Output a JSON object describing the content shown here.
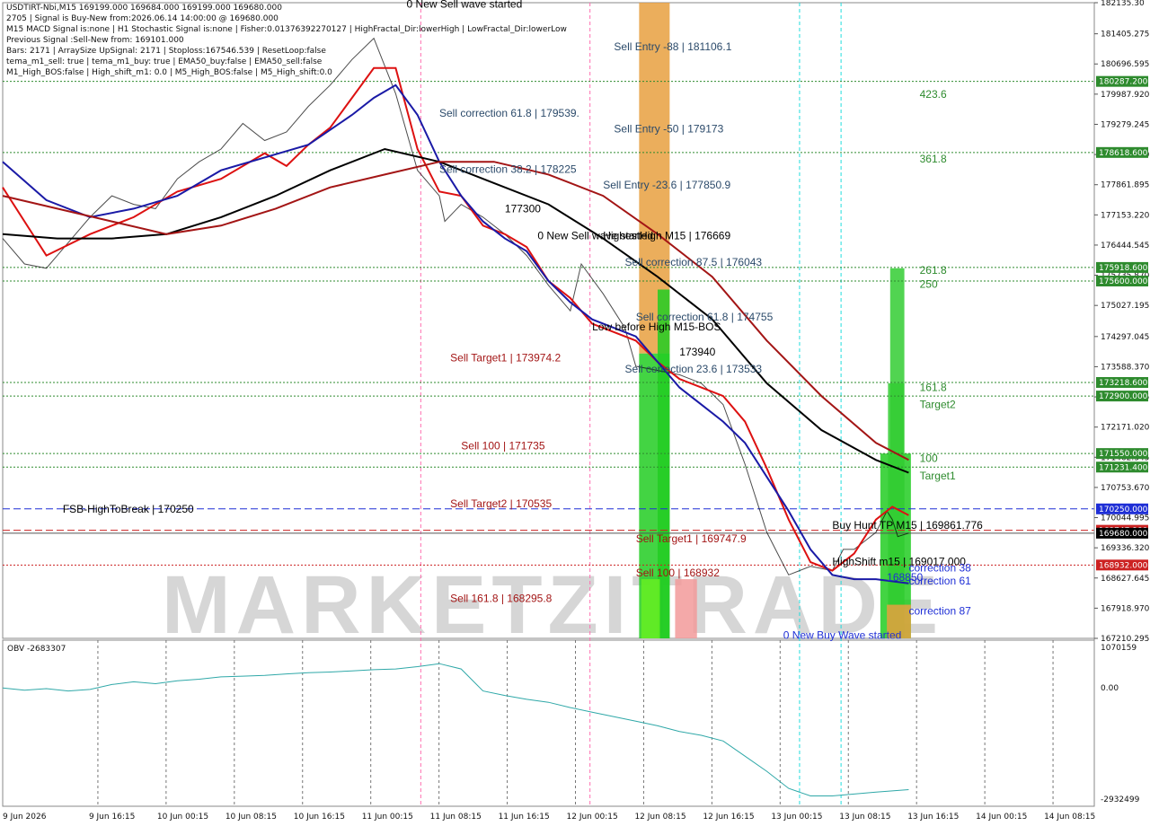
{
  "window": {
    "title": "USDTIRT-Nbi,M15  169199.000 169684.000 169199.000 169680.000"
  },
  "info_lines": [
    "USDTIRT-Nbi,M15  169199.000 169684.000 169199.000 169680.000",
    "2705 | Signal is Buy-New from:2026.06.14 14:00:00 @ 169680.000",
    "M15 MACD Signal is:none | H1 Stochastic Signal is:none | Fisher:0.01376392270127 | HighFractal_Dir:lowerHigh | LowFractal_Dir:lowerLow",
    "Previous Signal :Sell-New from: 169101.000",
    "Bars: 2171 | ArraySize UpSignal: 2171 | Stoploss:167546.539 | ResetLoop:false",
    "tema_m1_sell: true | tema_m1_buy: true | EMA50_buy:false | EMA50_sell:false",
    "M1_High_BOS:false | High_shift_m1: 0.0 | M5_High_BOS:false | M5_High_shift:0.0"
  ],
  "watermark": "MARKETZITRADE",
  "colors": {
    "ema_red": "#dd1111",
    "ema_blue": "#1a1aa6",
    "ema_black": "#000000",
    "ema_darkred": "#a31515",
    "level_green": "#2e8b2e",
    "level_red": "#cc2222",
    "level_blue": "#1f2fd6",
    "bar_green": "#22cc22",
    "bar_orange": "#e8a040",
    "obv_line": "#2fa8a8"
  },
  "chart_data": {
    "type": "line",
    "symbol": "USDTIRT-Nbi",
    "timeframe": "M15",
    "ylim": [
      167210.295,
      182135.3
    ],
    "price_ticks": [
      "182135.30",
      "181405.275",
      "180696.595",
      "179987.920",
      "179279.245",
      "178570.570",
      "177861.895",
      "177153.220",
      "176444.545",
      "175735.870",
      "175027.195",
      "174297.045",
      "173588.370",
      "172879.695",
      "172171.020",
      "171462.345",
      "170753.670",
      "170044.995",
      "169336.320",
      "168627.645",
      "167918.970",
      "167210.295"
    ],
    "time_labels": [
      "9 Jun 2026",
      "9 Jun 16:15",
      "10 Jun 00:15",
      "10 Jun 08:15",
      "10 Jun 16:15",
      "11 Jun 00:15",
      "11 Jun 08:15",
      "11 Jun 16:15",
      "12 Jun 00:15",
      "12 Jun 08:15",
      "12 Jun 16:15",
      "13 Jun 00:15",
      "13 Jun 08:15",
      "13 Jun 16:15",
      "14 Jun 00:15",
      "14 Jun 08:15"
    ],
    "price_tags": [
      {
        "value": 180287.2,
        "text": "180287.200",
        "color": "#2e8b2e"
      },
      {
        "value": 178618.6,
        "text": "178618.600",
        "color": "#2e8b2e"
      },
      {
        "value": 175918.6,
        "text": "175918.600",
        "color": "#2e8b2e"
      },
      {
        "value": 175600.0,
        "text": "175600.000",
        "color": "#2e8b2e"
      },
      {
        "value": 173218.6,
        "text": "173218.600",
        "color": "#2e8b2e"
      },
      {
        "value": 172900.0,
        "text": "172900.000",
        "color": "#2e8b2e"
      },
      {
        "value": 171550.0,
        "text": "171550.000",
        "color": "#2e8b2e"
      },
      {
        "value": 171231.4,
        "text": "171231.400",
        "color": "#2e8b2e"
      },
      {
        "value": 170250.0,
        "text": "170250.000",
        "color": "#1f2fd6"
      },
      {
        "value": 169747.9,
        "text": "169747.900",
        "color": "#cc2222"
      },
      {
        "value": 169680.0,
        "text": "169680.000",
        "color": "#000000"
      },
      {
        "value": 168932.0,
        "text": "168932.000",
        "color": "#cc2222"
      }
    ],
    "levels": [
      {
        "value": 180287.2,
        "color": "#2e8b2e",
        "style": "dotted"
      },
      {
        "value": 178618.6,
        "color": "#2e8b2e",
        "style": "dotted"
      },
      {
        "value": 175918.6,
        "color": "#2e8b2e",
        "style": "dotted"
      },
      {
        "value": 175600.0,
        "color": "#2e8b2e",
        "style": "dotted"
      },
      {
        "value": 173218.6,
        "color": "#2e8b2e",
        "style": "dotted"
      },
      {
        "value": 172900.0,
        "color": "#2e8b2e",
        "style": "dotted"
      },
      {
        "value": 171550.0,
        "color": "#2e8b2e",
        "style": "dotted"
      },
      {
        "value": 171231.4,
        "color": "#2e8b2e",
        "style": "dotted"
      },
      {
        "value": 170250.0,
        "color": "#1f2fd6",
        "style": "dashed"
      },
      {
        "value": 169747.9,
        "color": "#cc2222",
        "style": "dashed"
      },
      {
        "value": 169680.0,
        "color": "#555555",
        "style": "solid"
      },
      {
        "value": 168932.0,
        "color": "#cc2222",
        "style": "dotted"
      }
    ],
    "annotations": [
      {
        "text": "0 New Sell wave started",
        "value": 182100,
        "t": 0.37,
        "color": "#000000"
      },
      {
        "text": "Sell Entry -88 | 181106.1",
        "value": 181106.1,
        "t": 0.56,
        "color": "#2b4a6a"
      },
      {
        "text": "423.6",
        "value": 179987.9,
        "t": 0.84,
        "color": "#2e8b2e"
      },
      {
        "text": "Sell correction 61.8 | 179539.",
        "value": 179539,
        "t": 0.4,
        "color": "#2b4a6a"
      },
      {
        "text": "Sell Entry -50 | 179173",
        "value": 179173,
        "t": 0.56,
        "color": "#2b4a6a"
      },
      {
        "text": "361.8",
        "value": 178470,
        "t": 0.84,
        "color": "#2e8b2e"
      },
      {
        "text": "Sell correction 38.2 | 178225",
        "value": 178225,
        "t": 0.4,
        "color": "#2b4a6a"
      },
      {
        "text": "Sell Entry -23.6 | 177850.9",
        "value": 177850.9,
        "t": 0.55,
        "color": "#2b4a6a"
      },
      {
        "text": "177300",
        "value": 177300,
        "t": 0.46,
        "color": "#000000"
      },
      {
        "text": "0 New Sell wave started",
        "value": 176669,
        "t": 0.49,
        "color": "#000000"
      },
      {
        "text": "HighestHigh   M15 | 176669",
        "value": 176669,
        "t": 0.55,
        "color": "#000000"
      },
      {
        "text": "Sell correction 87.5 | 176043",
        "value": 176043,
        "t": 0.57,
        "color": "#2b4a6a"
      },
      {
        "text": "261.8",
        "value": 175850,
        "t": 0.84,
        "color": "#2e8b2e"
      },
      {
        "text": "250",
        "value": 175530,
        "t": 0.84,
        "color": "#2e8b2e"
      },
      {
        "text": "Sell correction 61.8 | 174755",
        "value": 174755,
        "t": 0.58,
        "color": "#2b4a6a"
      },
      {
        "text": "Low before High   M15-BOS",
        "value": 174530,
        "t": 0.54,
        "color": "#000000"
      },
      {
        "text": "173940",
        "value": 173940,
        "t": 0.62,
        "color": "#000000"
      },
      {
        "text": "Sell Target1 | 173974.2",
        "value": 173800,
        "t": 0.41,
        "color": "#a31515"
      },
      {
        "text": "Sell correction 23.6 | 173533",
        "value": 173533,
        "t": 0.57,
        "color": "#2b4a6a"
      },
      {
        "text": "161.8",
        "value": 173100,
        "t": 0.84,
        "color": "#2e8b2e"
      },
      {
        "text": "Target2",
        "value": 172700,
        "t": 0.84,
        "color": "#2e8b2e"
      },
      {
        "text": "Sell 100 | 171735",
        "value": 171735,
        "t": 0.42,
        "color": "#a31515"
      },
      {
        "text": "100",
        "value": 171440,
        "t": 0.84,
        "color": "#2e8b2e"
      },
      {
        "text": "Target1",
        "value": 171030,
        "t": 0.84,
        "color": "#2e8b2e"
      },
      {
        "text": "FSB-HighToBreak | 170250",
        "value": 170250,
        "t": 0.055,
        "color": "#000000"
      },
      {
        "text": "Sell Target2 | 170535",
        "value": 170370,
        "t": 0.41,
        "color": "#a31515"
      },
      {
        "text": "Buy Hunt TP M15 | 169861.776",
        "value": 169861.776,
        "t": 0.76,
        "color": "#000000"
      },
      {
        "text": "Sell Target1 | 169747.9",
        "value": 169550,
        "t": 0.58,
        "color": "#a31515"
      },
      {
        "text": "HighShift m15 | 169017.000",
        "value": 169017,
        "t": 0.76,
        "color": "#000000"
      },
      {
        "text": "correction 38",
        "value": 168860,
        "t": 0.83,
        "color": "#1f2fd6"
      },
      {
        "text": "Sell 100 | 168932",
        "value": 168750,
        "t": 0.58,
        "color": "#a31515"
      },
      {
        "text": "168850",
        "value": 168640,
        "t": 0.81,
        "color": "#1f2fd6"
      },
      {
        "text": "correction 61",
        "value": 168560,
        "t": 0.83,
        "color": "#1f2fd6"
      },
      {
        "text": "Sell 161.8 | 168295.8",
        "value": 168150,
        "t": 0.41,
        "color": "#a31515"
      },
      {
        "text": "correction 87",
        "value": 167850,
        "t": 0.83,
        "color": "#1f2fd6"
      },
      {
        "text": "0 New Buy Wave started",
        "value": 167280,
        "t": 0.715,
        "color": "#1f2fd6"
      }
    ],
    "series": [
      {
        "name": "Close",
        "color": "#000000",
        "x": [
          0,
          0.02,
          0.04,
          0.06,
          0.08,
          0.1,
          0.12,
          0.14,
          0.16,
          0.18,
          0.2,
          0.22,
          0.24,
          0.26,
          0.28,
          0.3,
          0.32,
          0.34,
          0.36,
          0.38,
          0.4,
          0.405,
          0.42,
          0.44,
          0.46,
          0.48,
          0.5,
          0.52,
          0.53,
          0.55,
          0.57,
          0.58,
          0.6,
          0.62,
          0.64,
          0.66,
          0.68,
          0.7,
          0.71,
          0.72,
          0.74,
          0.76,
          0.77,
          0.78,
          0.8,
          0.81,
          0.815,
          0.82,
          0.83
        ],
        "values": [
          176600,
          176000,
          175900,
          176500,
          177100,
          177600,
          177400,
          177300,
          178000,
          178400,
          178700,
          179300,
          178900,
          179100,
          179700,
          180200,
          180800,
          181300,
          180000,
          178200,
          177600,
          177000,
          177400,
          177100,
          176700,
          176200,
          175500,
          174900,
          176000,
          175300,
          174500,
          173600,
          173500,
          173400,
          173200,
          172700,
          171300,
          169700,
          169200,
          168700,
          168900,
          168800,
          169300,
          169300,
          169700,
          170200,
          170000,
          169600,
          169680
        ]
      },
      {
        "name": "EMA fast",
        "color": "#dd1111",
        "x": [
          0,
          0.04,
          0.08,
          0.12,
          0.16,
          0.2,
          0.24,
          0.26,
          0.28,
          0.3,
          0.32,
          0.34,
          0.36,
          0.38,
          0.4,
          0.42,
          0.44,
          0.46,
          0.48,
          0.5,
          0.52,
          0.54,
          0.56,
          0.58,
          0.6,
          0.62,
          0.64,
          0.66,
          0.68,
          0.7,
          0.72,
          0.74,
          0.76,
          0.78,
          0.8,
          0.815,
          0.83
        ],
        "values": [
          177800,
          176200,
          176700,
          177100,
          177700,
          178000,
          178600,
          178300,
          178800,
          179200,
          179900,
          180600,
          180600,
          178700,
          177700,
          177600,
          176900,
          176700,
          176400,
          175600,
          175200,
          174600,
          174400,
          174200,
          173700,
          173300,
          173100,
          172900,
          172300,
          171200,
          170000,
          169000,
          168800,
          169200,
          170000,
          170300,
          170100
        ]
      },
      {
        "name": "EMA mid",
        "color": "#1a1aa6",
        "x": [
          0,
          0.04,
          0.08,
          0.12,
          0.16,
          0.2,
          0.24,
          0.28,
          0.32,
          0.34,
          0.36,
          0.38,
          0.4,
          0.42,
          0.44,
          0.46,
          0.48,
          0.5,
          0.52,
          0.54,
          0.56,
          0.58,
          0.6,
          0.62,
          0.64,
          0.66,
          0.68,
          0.7,
          0.72,
          0.74,
          0.76,
          0.78,
          0.8,
          0.83
        ],
        "values": [
          178400,
          177500,
          177100,
          177300,
          177600,
          178200,
          178500,
          178800,
          179500,
          179900,
          180200,
          179500,
          178400,
          177600,
          177000,
          176600,
          176300,
          175600,
          175100,
          174700,
          174500,
          174300,
          173700,
          173100,
          172700,
          172300,
          171800,
          171000,
          170200,
          169300,
          168700,
          168600,
          168600,
          168500
        ]
      },
      {
        "name": "EMA slow",
        "color": "#000000",
        "x": [
          0,
          0.05,
          0.1,
          0.15,
          0.2,
          0.25,
          0.3,
          0.35,
          0.4,
          0.45,
          0.5,
          0.55,
          0.6,
          0.65,
          0.7,
          0.75,
          0.8,
          0.83
        ],
        "values": [
          176700,
          176600,
          176600,
          176700,
          177100,
          177600,
          178200,
          178700,
          178400,
          177900,
          177400,
          176600,
          175700,
          174700,
          173200,
          172100,
          171400,
          171100
        ]
      },
      {
        "name": "EMA slowest",
        "color": "#a31515",
        "x": [
          0,
          0.05,
          0.1,
          0.15,
          0.2,
          0.25,
          0.3,
          0.35,
          0.4,
          0.45,
          0.5,
          0.55,
          0.6,
          0.65,
          0.7,
          0.75,
          0.8,
          0.83
        ],
        "values": [
          177600,
          177300,
          177000,
          176700,
          176900,
          177300,
          177800,
          178100,
          178400,
          178400,
          178100,
          177600,
          176700,
          175700,
          174200,
          172900,
          171800,
          171400
        ]
      }
    ],
    "bars": [
      {
        "t0": 0.583,
        "t1": 0.611,
        "from": 167210,
        "to": 173900,
        "color": "#22cc22"
      },
      {
        "t0": 0.583,
        "t1": 0.611,
        "from": 173900,
        "to": 182135,
        "color": "#e8a040"
      },
      {
        "t0": 0.6,
        "t1": 0.611,
        "from": 167210,
        "to": 175400,
        "color": "#22cc22"
      },
      {
        "t0": 0.585,
        "t1": 0.602,
        "from": 167210,
        "to": 168600,
        "color": "#66ee22"
      },
      {
        "t0": 0.616,
        "t1": 0.636,
        "from": 167210,
        "to": 168600,
        "color": "#f29a9a"
      },
      {
        "t0": 0.804,
        "t1": 0.832,
        "from": 167210,
        "to": 171550,
        "color": "#22cc22"
      },
      {
        "t0": 0.811,
        "t1": 0.826,
        "from": 167210,
        "to": 173200,
        "color": "#33cc33"
      },
      {
        "t0": 0.813,
        "t1": 0.826,
        "from": 167210,
        "to": 175900,
        "color": "#33cc33"
      },
      {
        "t0": 0.81,
        "t1": 0.832,
        "from": 167210,
        "to": 168000,
        "color": "#e8a040"
      }
    ],
    "vlines": [
      {
        "t": 0.383,
        "color": "#ff6fb0"
      },
      {
        "t": 0.538,
        "color": "#ff6fb0"
      },
      {
        "t": 0.73,
        "color": "#22dddd"
      },
      {
        "t": 0.768,
        "color": "#22dddd"
      }
    ],
    "obv": {
      "label": "OBV -2683307",
      "ylim": [
        -2932499,
        1070159
      ],
      "ticks": [
        "1070159",
        "0.00",
        "-2932499"
      ],
      "x": [
        0,
        0.02,
        0.04,
        0.06,
        0.08,
        0.1,
        0.12,
        0.14,
        0.16,
        0.18,
        0.2,
        0.22,
        0.24,
        0.26,
        0.28,
        0.3,
        0.32,
        0.34,
        0.36,
        0.38,
        0.4,
        0.42,
        0.44,
        0.46,
        0.48,
        0.5,
        0.52,
        0.54,
        0.56,
        0.58,
        0.6,
        0.62,
        0.64,
        0.66,
        0.68,
        0.7,
        0.72,
        0.74,
        0.76,
        0.78,
        0.8,
        0.83
      ],
      "values": [
        0,
        -60000,
        -20000,
        -80000,
        -40000,
        90000,
        160000,
        110000,
        190000,
        230000,
        290000,
        310000,
        330000,
        370000,
        400000,
        420000,
        450000,
        480000,
        500000,
        560000,
        640000,
        500000,
        -80000,
        -200000,
        -300000,
        -380000,
        -520000,
        -640000,
        -760000,
        -880000,
        -1000000,
        -1150000,
        -1250000,
        -1400000,
        -1800000,
        -2200000,
        -2650000,
        -2850000,
        -2850000,
        -2800000,
        -2750000,
        -2683307
      ]
    }
  }
}
